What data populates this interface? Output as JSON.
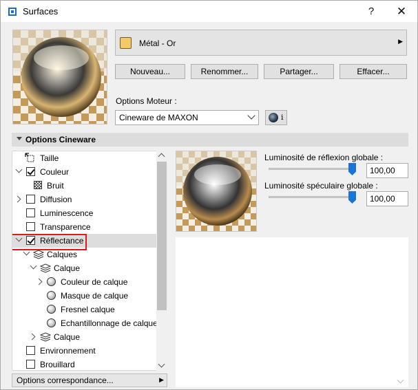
{
  "window": {
    "title": "Surfaces",
    "help_label": "?",
    "close_label": "✕",
    "icon": "surfaces-app-icon"
  },
  "material": {
    "name": "Métal - Or",
    "swatch_color": "#f4c96a",
    "more_icon": "chevron-right-icon"
  },
  "buttons": {
    "new": "Nouveau...",
    "rename": "Renommer...",
    "share": "Partager...",
    "clear": "Effacer..."
  },
  "engine": {
    "label": "Options Moteur :",
    "value": "Cineware de MAXON",
    "info_label": "i"
  },
  "section": {
    "title": "Options Cineware"
  },
  "tree": {
    "items": [
      {
        "label": "Taille",
        "icon": "size-icon"
      },
      {
        "label": "Couleur",
        "checked": true,
        "expanded": true
      },
      {
        "label": "Bruit",
        "icon": "noise-icon"
      },
      {
        "label": "Diffusion",
        "checked": false,
        "expanded": false
      },
      {
        "label": "Luminescence",
        "checked": false
      },
      {
        "label": "Transparence",
        "checked": false
      },
      {
        "label": "Réflectance",
        "checked": true,
        "expanded": true,
        "selected": true
      },
      {
        "label": "Calques",
        "icon": "layers-icon",
        "expanded": true
      },
      {
        "label": "Calque",
        "icon": "layers-icon",
        "expanded": true
      },
      {
        "label": "Couleur de calque",
        "icon": "sphere-icon",
        "expanded": false
      },
      {
        "label": "Masque de calque",
        "icon": "sphere-icon"
      },
      {
        "label": "Fresnel calque",
        "icon": "sphere-icon"
      },
      {
        "label": "Echantillonnage de calque",
        "icon": "sphere-icon"
      },
      {
        "label": "Calque",
        "icon": "layers-icon",
        "expanded": false
      },
      {
        "label": "Environnement",
        "checked": false
      },
      {
        "label": "Brouillard",
        "checked": false
      }
    ]
  },
  "correspondence": {
    "label": "Options correspondance..."
  },
  "params": {
    "reflection": {
      "label": "Luminosité de réflexion globale :",
      "value": "100,00",
      "level": 1.0
    },
    "specular": {
      "label": "Luminosité spéculaire globale :",
      "value": "100,00",
      "level": 1.0
    }
  },
  "colors": {
    "highlight": "#e0181b",
    "slider_handle": "#1a74d6",
    "gold": "#f4c96a"
  }
}
